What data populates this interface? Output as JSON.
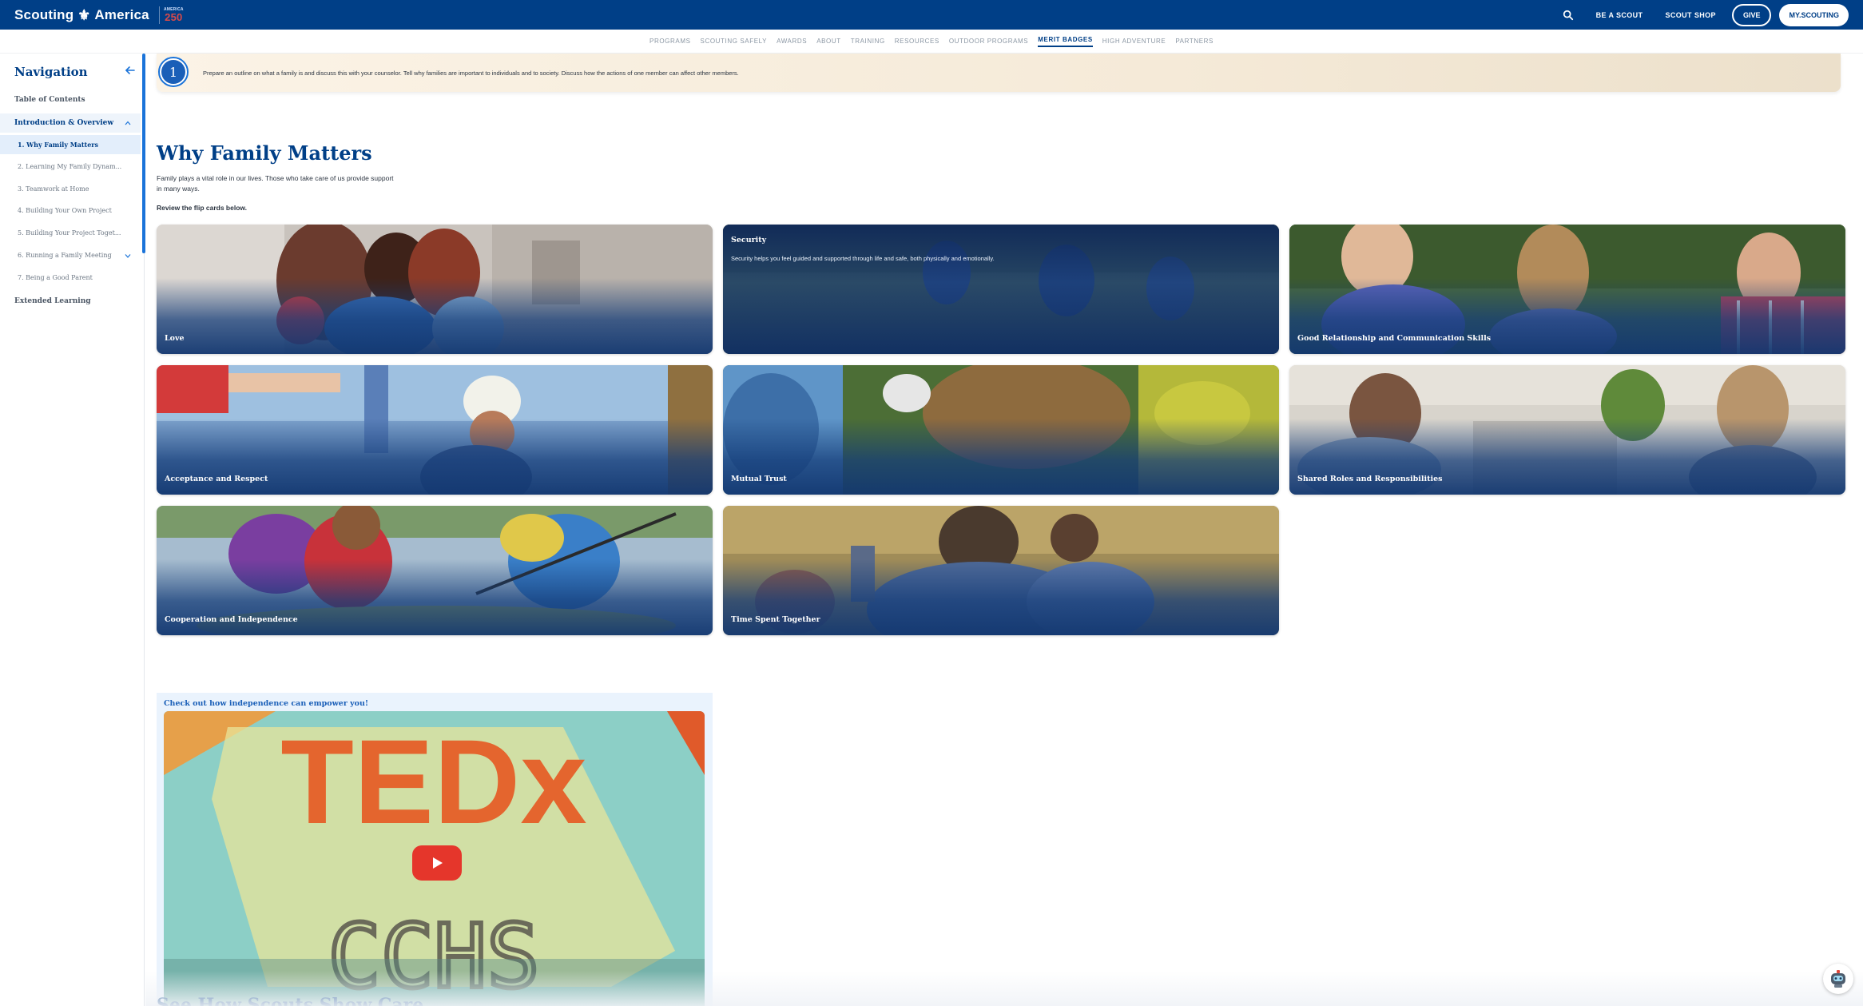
{
  "header": {
    "brand_left": "Scouting",
    "brand_right": "America",
    "anniv_top": "AMERICA",
    "anniv_num": "250",
    "links": [
      "BE A SCOUT",
      "SCOUT SHOP"
    ],
    "give_label": "GIVE",
    "my_label": "MY.SCOUTING"
  },
  "subnav": {
    "items": [
      "PROGRAMS",
      "SCOUTING SAFELY",
      "AWARDS",
      "ABOUT",
      "TRAINING",
      "RESOURCES",
      "OUTDOOR PROGRAMS",
      "MERIT BADGES",
      "HIGH ADVENTURE",
      "PARTNERS"
    ],
    "active": "MERIT BADGES"
  },
  "sidebar": {
    "title": "Navigation",
    "toc": "Table of Contents",
    "section_open": "Introduction & Overview",
    "items": [
      "1. Why Family Matters",
      "2. Learning My Family Dynam...",
      "3. Teamwork at Home",
      "4. Building Your Own Project",
      "5. Building Your Project Toget...",
      "6. Running a Family Meeting",
      "7. Being a Good Parent"
    ],
    "extended": "Extended Learning"
  },
  "requirement": {
    "number": "1",
    "text": "Prepare an outline on what a family is and discuss this with your counselor. Tell why families are important to individuals and to society. Discuss how the actions of one member can affect other members."
  },
  "main": {
    "title": "Why Family Matters",
    "intro": "Family plays a vital role in our lives. Those who take care of us provide support in many ways.",
    "review": "Review the flip cards below.",
    "cards": [
      {
        "label": "Love"
      },
      {
        "label": "Security",
        "desc": "Security helps you feel guided and supported through life and safe, both physically and emotionally."
      },
      {
        "label": "Good Relationship and Communication Skills"
      },
      {
        "label": "Acceptance and Respect"
      },
      {
        "label": "Mutual Trust"
      },
      {
        "label": "Shared Roles and Responsibilities"
      },
      {
        "label": "Cooperation and Independence"
      },
      {
        "label": "Time Spent Together"
      }
    ],
    "video_caption": "Check out how independence can empower you!",
    "video_text_top": "TEDx",
    "video_text_bottom": "CCHS",
    "next_title": "See How Scouts Show Care"
  },
  "colors": {
    "brand_blue": "#003f87",
    "accent_blue": "#1a73d9",
    "play_red": "#e5362b"
  }
}
